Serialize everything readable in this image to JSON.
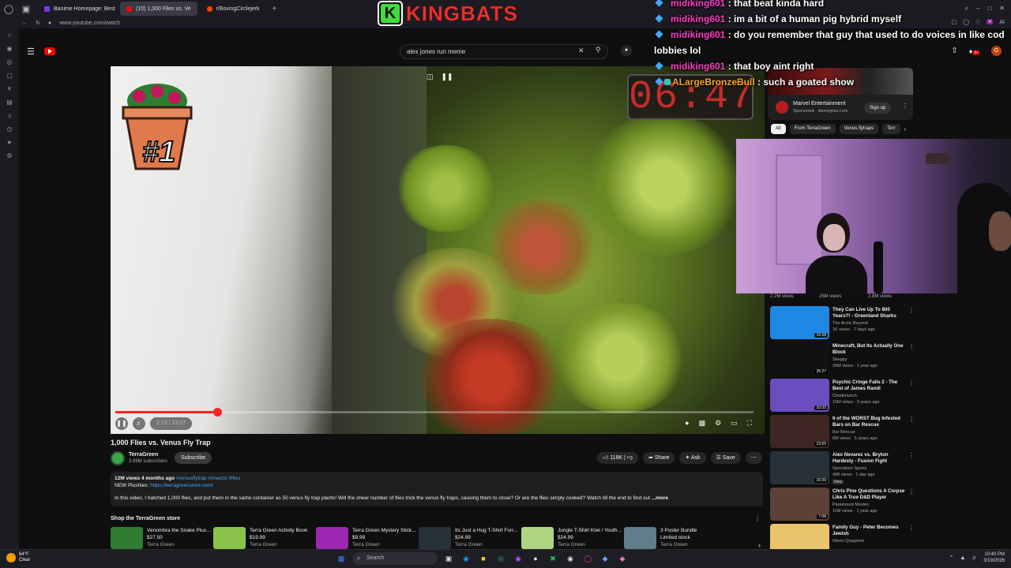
{
  "browser": {
    "tabs": [
      {
        "label": "Banime Homepage: Best",
        "color": "#7c3aed"
      },
      {
        "label": "(10) 1,000 Flies vs. Ve",
        "color": "#ff0000"
      },
      {
        "label": "r/BoxingCirclejerk",
        "color": "#ff4500"
      }
    ],
    "url": "www.youtube.com/watch"
  },
  "overlay": {
    "logo_letter": "K",
    "logo_text": "KINGBATS",
    "chat": [
      {
        "user": "midiking601",
        "text": "that beat kinda hard"
      },
      {
        "user": "midiking601",
        "text": "im a bit of a human pig hybrid myself"
      },
      {
        "user": "midiking601",
        "text": "do you remember that guy that used to do voices in like cod lobbies lol"
      },
      {
        "user": "midiking601",
        "text": "that boy aint right"
      },
      {
        "user": "ALargeBronzeBull",
        "text": "such a goated show"
      }
    ]
  },
  "youtube": {
    "search_value": "alex jones run  meme",
    "notif_count": "9+",
    "avatar_letter": "G",
    "video": {
      "rank_label": "#1",
      "timer": "06:47",
      "progress_percent": 16,
      "time": "2:13 / 13:07",
      "title": "1,000 Flies vs. Venus Fly Trap"
    },
    "channel": {
      "name": "TerraGreen",
      "subs": "3.89M subscribers",
      "subscribe": "Subscribe"
    },
    "actions": {
      "likes": "118K",
      "share": "Share",
      "ask": "Ask",
      "save": "Save"
    },
    "description": {
      "meta": "12M views  4 months ago",
      "tags": "#venusflytrap #insects #flies",
      "plush_label": "NEW Plushies",
      "plush_link": "https://terragreenstore.com/",
      "body": "In this video, I hatched 1,000 flies, and put them in the same container as 50 venus fly trap plants! Will the sheer number of flies trick the venus fly traps, causing them to close? Or are the flies simply cooked? Watch till the end to find out",
      "more": "...more"
    },
    "store": {
      "title": "Shop the TerraGreen store",
      "products": [
        {
          "title": "Venombra the Snake Plush...",
          "price": "$27.50",
          "seller": "Terra Green",
          "color": "#2e7d32"
        },
        {
          "title": "Terra Green Activity Book",
          "price": "$19.99",
          "seller": "Terra Green",
          "color": "#8bc34a"
        },
        {
          "title": "Terra Green Mystery Stick...",
          "price": "$9.99",
          "seller": "Terra Green",
          "color": "#9c27b0"
        },
        {
          "title": "Its Just a Hug T-Shirt Forr...",
          "price": "$24.99",
          "seller": "Terra Green",
          "color": "#263238"
        },
        {
          "title": "Jungle T-Shirt Kiwi / Youth...",
          "price": "$24.99",
          "seller": "Terra Green",
          "color": "#aed581"
        },
        {
          "title": "3 Poster Bundle",
          "price": "Limited stock",
          "seller": "Terra Green",
          "color": "#607d8b"
        }
      ]
    },
    "ad": {
      "name": "Marvel Entertainment",
      "sub": "Sponsored · disneyplus.com",
      "button": "Sign up"
    },
    "chips": [
      "All",
      "From TerraGreen",
      "Venus flytraps",
      "Terr"
    ],
    "views_row": [
      "2.2M views",
      "26M views",
      "2.8M views"
    ],
    "recommendations": [
      {
        "title": "They Can Live Up To 800 Years?! - Greenland Sharks Pa...",
        "channel": "The Arctic Beyond",
        "meta": "1K views · 7 days ago",
        "duration": "15:58",
        "badge": "",
        "color": "#1e88e5"
      },
      {
        "title": "Minecraft, But Its Actually One Block",
        "channel": "Skeppy",
        "meta": "25M views · 1 year ago",
        "duration": "35:27",
        "badge": "",
        "color": "#111111"
      },
      {
        "title": "Psychic Cringe Fails 2 - The Best of James Randi",
        "channel": "Chodimunch",
        "meta": "10M views · 9 years ago",
        "duration": "10:32",
        "badge": "",
        "color": "#6a4ec0"
      },
      {
        "title": "6 of the WORST Bug Infested Bars on Bar Rescue",
        "channel": "Bar Rescue",
        "meta": "6M views · 5 years ago",
        "duration": "23:55",
        "badge": "",
        "color": "#3e2723"
      },
      {
        "title": "Alex Nevarez vs. Bryton Hardesty - Fusion Fight Leagu...",
        "channel": "Spectation Sports",
        "meta": "498 views · 1 day ago",
        "duration": "10:39",
        "badge": "New",
        "color": "#263238"
      },
      {
        "title": "Chris Pine Questions A Corpse Like A True D&D Player",
        "channel": "Paramount Movies",
        "meta": "11M views · 1 year ago",
        "duration": "7:08",
        "badge": "",
        "color": "#5d4037"
      },
      {
        "title": "Family Guy - Peter Becomes Jewish",
        "channel": "Glenn Quagmire",
        "meta": "",
        "duration": "",
        "badge": "",
        "color": "#e9c46a"
      }
    ]
  },
  "taskbar": {
    "temp": "64°F",
    "cond": "Clear",
    "search": "Search",
    "time": "10:40 PM",
    "date": "3/19/2026"
  }
}
